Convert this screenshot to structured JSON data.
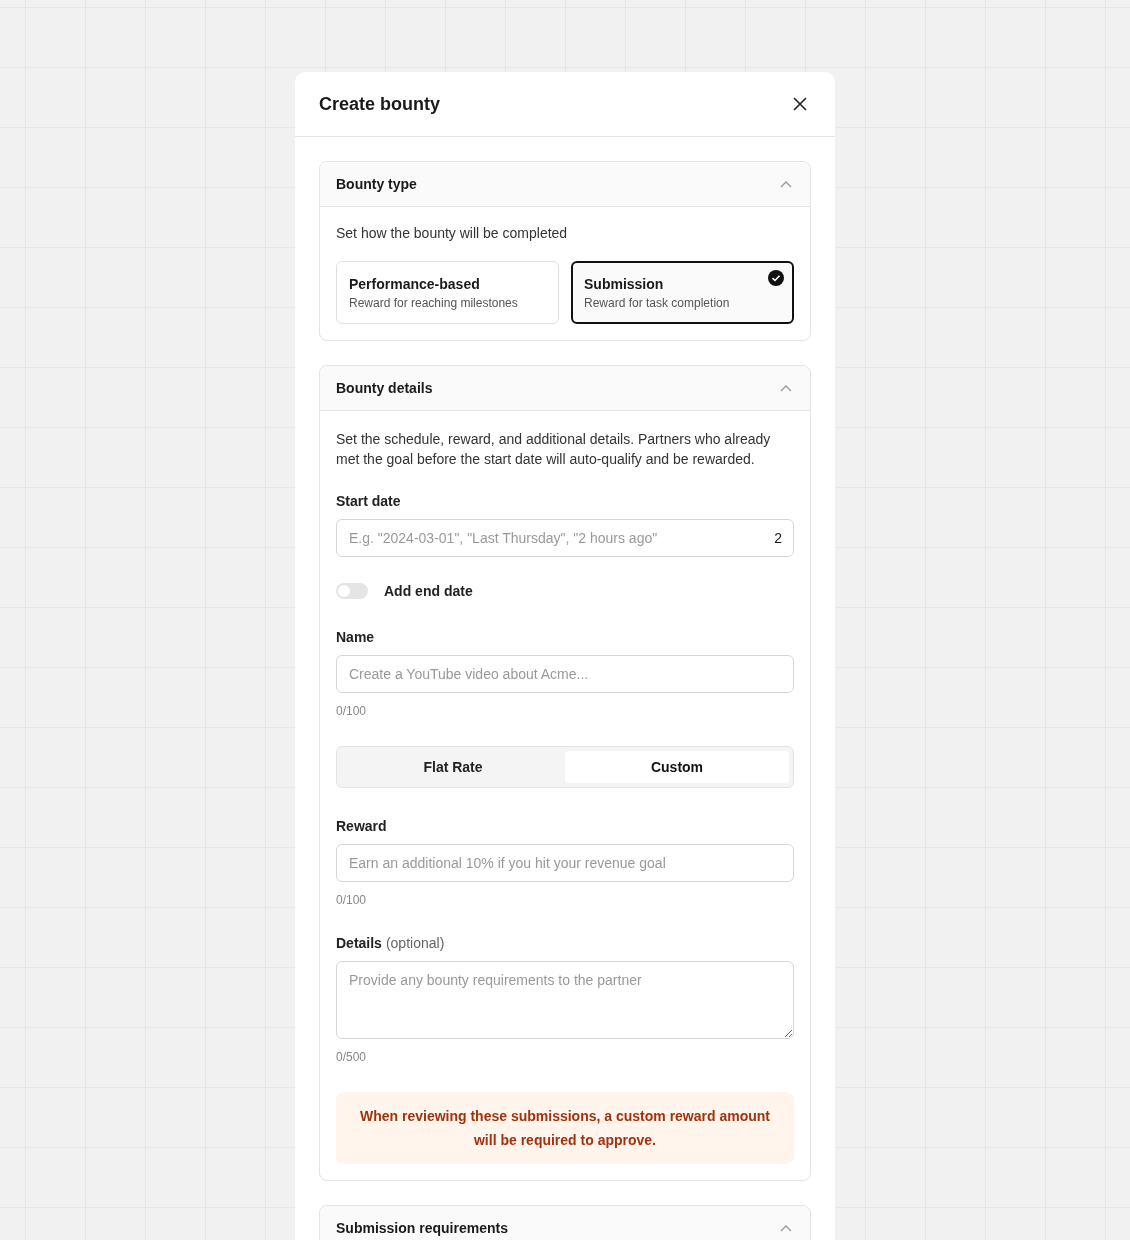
{
  "dialog": {
    "title": "Create bounty"
  },
  "bounty_type": {
    "title": "Bounty type",
    "expanded": true,
    "description": "Set how the bounty will be completed",
    "options": [
      {
        "title": "Performance-based",
        "subtitle": "Reward for reaching milestones",
        "selected": false
      },
      {
        "title": "Submission",
        "subtitle": "Reward for task completion",
        "selected": true
      }
    ]
  },
  "bounty_details": {
    "title": "Bounty details",
    "expanded": true,
    "description": "Set the schedule, reward, and additional details. Partners who already met the goal before the start date will auto-qualify and be rewarded.",
    "start_date": {
      "label": "Start date",
      "placeholder": "E.g. \"2024-03-01\", \"Last Thursday\", \"2 hours ago\"",
      "preview": "2"
    },
    "end_date_toggle": {
      "label": "Add end date",
      "on": false
    },
    "name": {
      "label": "Name",
      "placeholder": "Create a YouTube video about Acme...",
      "counter": "0/100"
    },
    "reward_type": [
      {
        "label": "Flat Rate",
        "selected": false
      },
      {
        "label": "Custom",
        "selected": true
      }
    ],
    "reward": {
      "label": "Reward",
      "placeholder": "Earn an additional 10% if you hit your revenue goal",
      "counter": "0/100"
    },
    "details": {
      "label": "Details",
      "hint": "(optional)",
      "placeholder": "Provide any bounty requirements to the partner",
      "counter": "0/500"
    },
    "notice": "When reviewing these submissions, a custom reward amount will be required to approve."
  },
  "submission_requirements": {
    "title": "Submission requirements",
    "expanded": true
  }
}
